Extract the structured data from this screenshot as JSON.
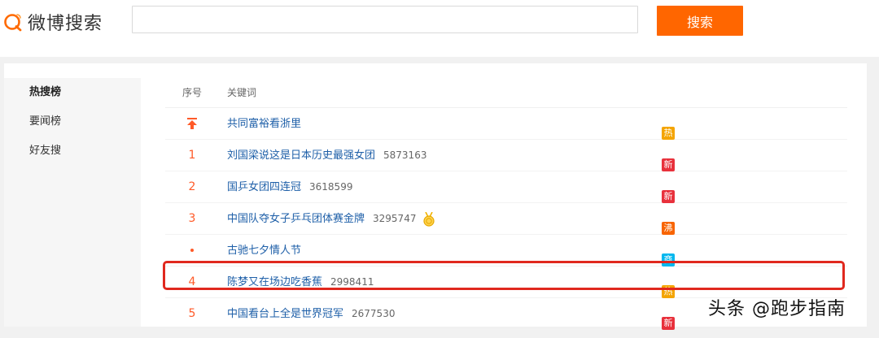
{
  "header": {
    "logo_text": "微博搜索",
    "search_placeholder": "",
    "search_button": "搜索"
  },
  "sidebar": {
    "items": [
      {
        "label": "热搜榜",
        "active": true
      },
      {
        "label": "要闻榜",
        "active": false
      },
      {
        "label": "好友搜",
        "active": false
      }
    ]
  },
  "table": {
    "headers": {
      "rank": "序号",
      "keyword": "关键词"
    },
    "rows": [
      {
        "rank": "",
        "rank_icon": "pin-top-icon",
        "keyword": "共同富裕看浙里",
        "count": "",
        "tag": "热",
        "tag_color": "#f4a400"
      },
      {
        "rank": "1",
        "keyword": "刘国梁说这是日本历史最强女团",
        "count": "5873163",
        "tag": "新",
        "tag_color": "#e8313c"
      },
      {
        "rank": "2",
        "keyword": "国乒女团四连冠",
        "count": "3618599",
        "tag": "新",
        "tag_color": "#e8313c"
      },
      {
        "rank": "3",
        "keyword": "中国队夺女子乒乓团体赛金牌",
        "count": "3295747",
        "medal_icon": "gold-medal-icon",
        "tag": "沸",
        "tag_color": "#f86400"
      },
      {
        "rank": "",
        "rank_icon": "dot-icon",
        "keyword": "古驰七夕情人节",
        "count": "",
        "tag": "商",
        "tag_color": "#00b7ee"
      },
      {
        "rank": "4",
        "keyword": "陈梦又在场边吃香蕉",
        "count": "2998411",
        "tag": "热",
        "tag_color": "#f4a400"
      },
      {
        "rank": "5",
        "keyword": "中国看台上全是世界冠军",
        "count": "2677530",
        "tag": "新",
        "tag_color": "#e8313c"
      }
    ]
  },
  "watermark": "头条 @跑步指南",
  "colors": {
    "accent": "#ff6600",
    "link": "#1e5fa8",
    "rank": "#ff5a28",
    "highlight_border": "#e0281e"
  }
}
